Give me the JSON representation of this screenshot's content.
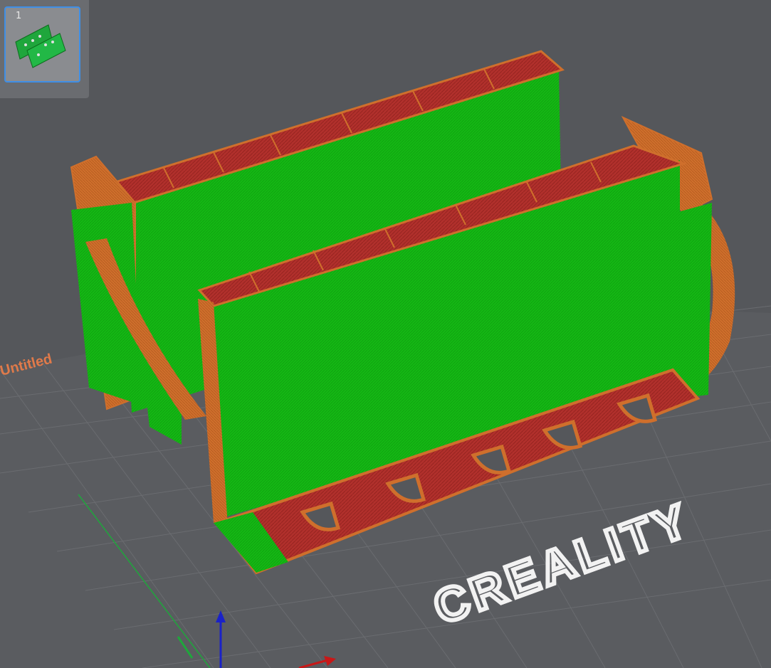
{
  "plate_panel": {
    "plate_number": "1"
  },
  "viewport": {
    "plate_name": "Untitled",
    "bed_brand": "CREALITY"
  },
  "colors": {
    "background": "#55575b",
    "wall": "#14b814",
    "perimeter": "#cf6f2c",
    "top_surface": "#b1302c",
    "selection": "#3f8fe6",
    "axis_x": "#c81818",
    "axis_y": "#1fa63c",
    "axis_z": "#1a22c8",
    "plate_label": "#e07a4a"
  },
  "icons": [
    "model-thumbnail-icon",
    "axis-gizmo-icon"
  ]
}
